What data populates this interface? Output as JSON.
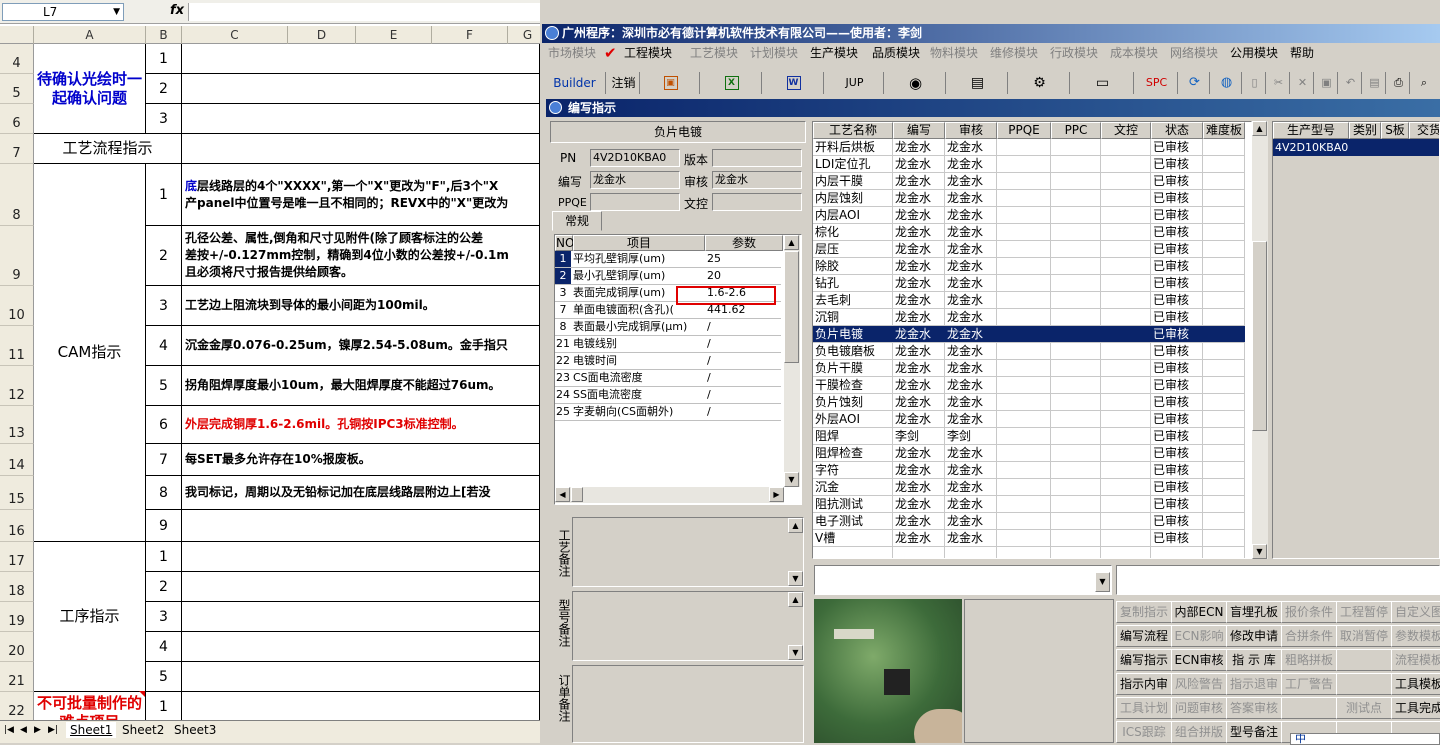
{
  "excel": {
    "namebox": "L7",
    "fx": "fx",
    "columns": [
      "A",
      "B",
      "C",
      "D",
      "E",
      "F",
      "G"
    ],
    "row_numbers": [
      "4",
      "5",
      "6",
      "7",
      "8",
      "9",
      "10",
      "11",
      "12",
      "13",
      "14",
      "15",
      "16",
      "17",
      "18",
      "19",
      "20",
      "21",
      "22"
    ],
    "group_confirm": "待确认光绘时一起确认问题",
    "group_flow": "工艺流程指示",
    "group_cam": "CAM指示",
    "group_process": "工序指示",
    "group_difficult": "不可批量制作的难点项目",
    "b_confirm": [
      "1",
      "2",
      "3"
    ],
    "b_cam": [
      "1",
      "2",
      "3",
      "4",
      "5",
      "6",
      "7",
      "8",
      "9"
    ],
    "b_process": [
      "1",
      "2",
      "3",
      "4",
      "5"
    ],
    "b_difficult": [
      "1"
    ],
    "cam_first_char": "底",
    "cam_texts": [
      "层线路层的4个\"XXXX\",第一个\"X\"更改为\"F\",后3个\"X",
      "产panel中位置号是唯一且不相同的；REVX中的\"X\"更改为",
      "孔径公差、属性,倒角和尺寸见附件(除了顾客标注的公差",
      "差按+/-0.127mm控制，精确到4位小数的公差按+/-0.1m",
      "且必须将尺寸报告提供给顾客。",
      "工艺边上阻流块到导体的最小间距为100mil。",
      "沉金金厚0.076-0.25um，镍厚2.54-5.08um。金手指只",
      "拐角阻焊厚度最小10um，最大阻焊厚度不能超过76um。 ",
      "外层完成铜厚1.6-2.6mil。孔铜按IPC3标准控制。",
      "每SET最多允许存在10%报废板。",
      "我司标记，周期以及无铅标记加在底层线路层附边上[若没"
    ],
    "sheet_tabs": [
      "Sheet1",
      "Sheet2",
      "Sheet3"
    ]
  },
  "app": {
    "title": "广州程序：深圳市必有德计算机软件技术有限公司——使用者：李剑",
    "menu": [
      {
        "label": "市场模块",
        "enabled": false
      },
      {
        "label": "工程模块",
        "enabled": true
      },
      {
        "label": "工艺模块",
        "enabled": false
      },
      {
        "label": "计划模块",
        "enabled": false
      },
      {
        "label": "生产模块",
        "enabled": true
      },
      {
        "label": "品质模块",
        "enabled": true
      },
      {
        "label": "物料模块",
        "enabled": false
      },
      {
        "label": "维修模块",
        "enabled": false
      },
      {
        "label": "行政模块",
        "enabled": false
      },
      {
        "label": "成本模块",
        "enabled": false
      },
      {
        "label": "网络模块",
        "enabled": false
      },
      {
        "label": "公用模块",
        "enabled": true
      },
      {
        "label": "帮助",
        "enabled": true
      }
    ],
    "toolbar": {
      "builder": "Builder",
      "logout": "注销",
      "jup": "JUP",
      "spc": "SPC",
      "w": "W",
      "x": "X"
    },
    "child_title": "编写指示",
    "process_title": "负片电镀",
    "pn_label": "PN",
    "pn_value": "4V2D10KBA0",
    "version_label": "版本",
    "version_value": "",
    "writer_label": "编写",
    "writer_value": "龙金水",
    "reviewer_label": "审核",
    "reviewer_value": "龙金水",
    "ppqe_label": "PPQE",
    "ppqe_value": "",
    "doc_label": "文控",
    "doc_value": "",
    "tab_general": "常规",
    "param_headers": {
      "no": "NO",
      "item": "项目",
      "value": "参数"
    },
    "params": [
      {
        "no": "1",
        "item": "平均孔壁铜厚(um)",
        "value": "25"
      },
      {
        "no": "2",
        "item": "最小孔壁铜厚(um)",
        "value": "20"
      },
      {
        "no": "3",
        "item": "表面完成铜厚(um)",
        "value": "1.6-2.6"
      },
      {
        "no": "7",
        "item": "单面电镀面积(含孔)(",
        "value": "441.62"
      },
      {
        "no": "8",
        "item": "表面最小完成铜厚(μm)",
        "value": "/"
      },
      {
        "no": "21",
        "item": "电镀线别",
        "value": "/"
      },
      {
        "no": "22",
        "item": "电镀时间",
        "value": "/"
      },
      {
        "no": "23",
        "item": "CS面电流密度",
        "value": "/"
      },
      {
        "no": "24",
        "item": "SS面电流密度",
        "value": "/"
      },
      {
        "no": "25",
        "item": "字麦朝向(CS面朝外)",
        "value": "/"
      }
    ],
    "notes_process": "工艺备注",
    "notes_model": "型号备注",
    "notes_order": "订单备注",
    "proc_headers": [
      "工艺名称",
      "编写",
      "审核",
      "PPQE",
      "PPC",
      "文控",
      "状态",
      "难度板"
    ],
    "processes": [
      {
        "name": "开料后烘板",
        "w": "龙金水",
        "r": "龙金水",
        "s": "已审核"
      },
      {
        "name": "LDI定位孔",
        "w": "龙金水",
        "r": "龙金水",
        "s": "已审核"
      },
      {
        "name": "内层干膜",
        "w": "龙金水",
        "r": "龙金水",
        "s": "已审核"
      },
      {
        "name": "内层蚀刻",
        "w": "龙金水",
        "r": "龙金水",
        "s": "已审核"
      },
      {
        "name": "内层AOI",
        "w": "龙金水",
        "r": "龙金水",
        "s": "已审核"
      },
      {
        "name": "棕化",
        "w": "龙金水",
        "r": "龙金水",
        "s": "已审核"
      },
      {
        "name": "层压",
        "w": "龙金水",
        "r": "龙金水",
        "s": "已审核"
      },
      {
        "name": "除胶",
        "w": "龙金水",
        "r": "龙金水",
        "s": "已审核"
      },
      {
        "name": "钻孔",
        "w": "龙金水",
        "r": "龙金水",
        "s": "已审核"
      },
      {
        "name": "去毛刺",
        "w": "龙金水",
        "r": "龙金水",
        "s": "已审核"
      },
      {
        "name": "沉铜",
        "w": "龙金水",
        "r": "龙金水",
        "s": "已审核"
      },
      {
        "name": "负片电镀",
        "w": "龙金水",
        "r": "龙金水",
        "s": "已审核"
      },
      {
        "name": "负电镀磨板",
        "w": "龙金水",
        "r": "龙金水",
        "s": "已审核"
      },
      {
        "name": "负片干膜",
        "w": "龙金水",
        "r": "龙金水",
        "s": "已审核"
      },
      {
        "name": "干膜检查",
        "w": "龙金水",
        "r": "龙金水",
        "s": "已审核"
      },
      {
        "name": "负片蚀刻",
        "w": "龙金水",
        "r": "龙金水",
        "s": "已审核"
      },
      {
        "name": "外层AOI",
        "w": "龙金水",
        "r": "龙金水",
        "s": "已审核"
      },
      {
        "name": "阻焊",
        "w": "李剑",
        "r": "李剑",
        "s": "已审核"
      },
      {
        "name": "阻焊检查",
        "w": "龙金水",
        "r": "龙金水",
        "s": "已审核"
      },
      {
        "name": "字符",
        "w": "龙金水",
        "r": "龙金水",
        "s": "已审核"
      },
      {
        "name": "沉金",
        "w": "龙金水",
        "r": "龙金水",
        "s": "已审核"
      },
      {
        "name": "阻抗测试",
        "w": "龙金水",
        "r": "龙金水",
        "s": "已审核"
      },
      {
        "name": "电子测试",
        "w": "龙金水",
        "r": "龙金水",
        "s": "已审核"
      },
      {
        "name": "V槽",
        "w": "龙金水",
        "r": "龙金水",
        "s": "已审核"
      }
    ],
    "right_headers": [
      "生产型号",
      "类别",
      "S板",
      "交货"
    ],
    "right_rows": [
      {
        "model": "4V2D10KBA0"
      }
    ],
    "buttons": [
      [
        {
          "l": "复制指示",
          "e": false
        },
        {
          "l": "内部ECN",
          "e": true
        },
        {
          "l": "盲埋孔板",
          "e": true
        },
        {
          "l": "报价条件",
          "e": false
        },
        {
          "l": "工程暂停",
          "e": false
        },
        {
          "l": "自定义图",
          "e": false
        }
      ],
      [
        {
          "l": "编写流程",
          "e": true
        },
        {
          "l": "ECN影响",
          "e": false
        },
        {
          "l": "修改申请",
          "e": true
        },
        {
          "l": "合拼条件",
          "e": false
        },
        {
          "l": "取消暂停",
          "e": false
        },
        {
          "l": "参数模板",
          "e": false
        }
      ],
      [
        {
          "l": "编写指示",
          "e": true
        },
        {
          "l": "ECN审核",
          "e": true
        },
        {
          "l": "指 示 库",
          "e": true
        },
        {
          "l": "粗略拼板",
          "e": false
        },
        {
          "l": "",
          "e": false
        },
        {
          "l": "流程模板",
          "e": false
        }
      ],
      [
        {
          "l": "指示内审",
          "e": true
        },
        {
          "l": "风险警告",
          "e": false
        },
        {
          "l": "指示退审",
          "e": false
        },
        {
          "l": "工厂警告",
          "e": false
        },
        {
          "l": "",
          "e": false
        },
        {
          "l": "工具模板",
          "e": true
        }
      ],
      [
        {
          "l": "工具计划",
          "e": false
        },
        {
          "l": "问题审核",
          "e": false
        },
        {
          "l": "答案审核",
          "e": false
        },
        {
          "l": "",
          "e": false
        },
        {
          "l": "测试点",
          "e": false
        },
        {
          "l": "工具完成",
          "e": true
        }
      ],
      [
        {
          "l": "ICS跟踪",
          "e": false
        },
        {
          "l": "组合拼版",
          "e": false
        },
        {
          "l": "型号备注",
          "e": true
        },
        {
          "l": "",
          "e": false
        },
        {
          "l": "",
          "e": false
        },
        {
          "l": "",
          "e": false
        }
      ]
    ],
    "ime": "中",
    "colors": {
      "titlebar": "#0a246a",
      "red_box": "#e00000",
      "sel_row": "#0a246a"
    }
  }
}
